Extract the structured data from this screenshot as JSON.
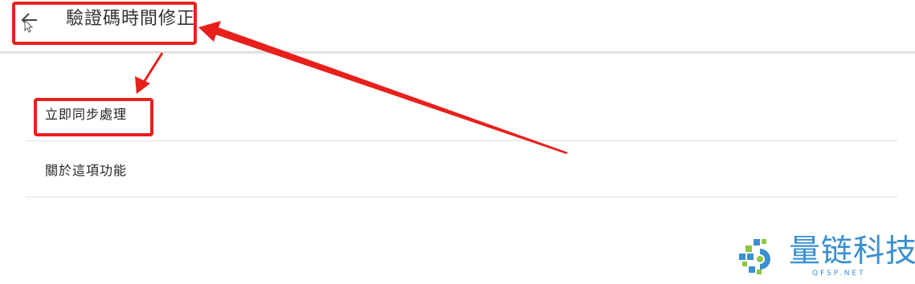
{
  "header": {
    "title": "驗證碼時間修正",
    "back_icon": "arrow-left-icon"
  },
  "list": {
    "items": [
      {
        "label": "立即同步處理"
      },
      {
        "label": "關於這項功能"
      }
    ]
  },
  "annotation": {
    "color": "#e8201c"
  },
  "watermark": {
    "brand": "量链科技",
    "domain": "QFSP.NET",
    "color": "#3a8fd0"
  }
}
